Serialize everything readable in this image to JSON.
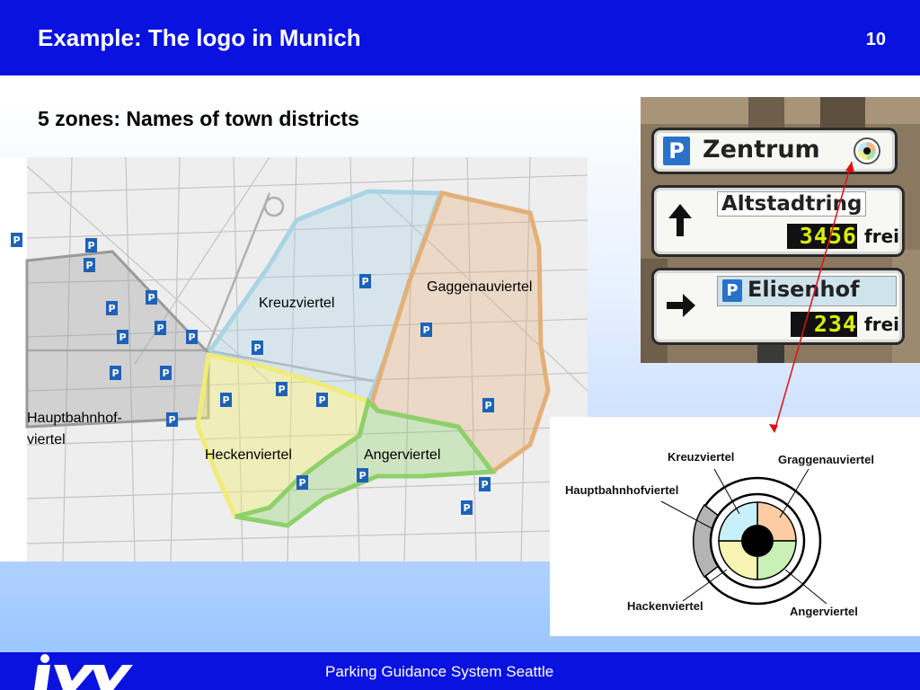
{
  "header": {
    "title": "Example: The logo in Munich",
    "slide_number": "10"
  },
  "subtitle": "5 zones: Names of town districts",
  "map": {
    "labels": {
      "kreuzviertel": "Kreuzviertel",
      "gaggenauviertel": "Gaggenauviertel",
      "hauptbahnhof_line1": "Hauptbahnhof-",
      "hauptbahnhof_line2": "viertel",
      "heckenviertel": "Heckenviertel",
      "angerviertel": "Angerviertel"
    },
    "zone_colors": {
      "kreuzviertel": "#a9d4e4",
      "gaggenauviertel": "#e4b07a",
      "hauptbahnhofviertel": "#9a9a9a",
      "heckenviertel": "#f0ec78",
      "angerviertel": "#8ed06a"
    },
    "parking_icon": "parking-p-icon"
  },
  "photo": {
    "sign1": {
      "badge": "P",
      "text": "Zentrum",
      "icon": "district-logo-icon"
    },
    "sign2": {
      "arrow": "up-arrow-icon",
      "text": "Altstadtring",
      "count": "3456",
      "status": "frei"
    },
    "sign3": {
      "arrow": "right-arrow-icon",
      "badge": "P",
      "text": "Elisenhof",
      "count": "234",
      "status": "frei"
    }
  },
  "logo_diagram": {
    "labels": {
      "kreuzviertel": "Kreuzviertel",
      "graggenauviertel": "Graggenauviertel",
      "hauptbahnhofviertel": "Hauptbahnhofviertel",
      "hackenviertel": "Hackenviertel",
      "angerviertel": "Angerviertel"
    },
    "colors": {
      "top_left": "#c8f0fa",
      "top_right": "#fccda3",
      "bottom_left": "#f8f5b4",
      "bottom_right": "#c9f0b5",
      "left_segment": "#b4b4b4",
      "ring": "#ffffff",
      "center": "#000000"
    }
  },
  "arrow_color": "#e01010",
  "footer": {
    "text": "Parking Guidance System Seattle",
    "logo_text": "ivv"
  }
}
